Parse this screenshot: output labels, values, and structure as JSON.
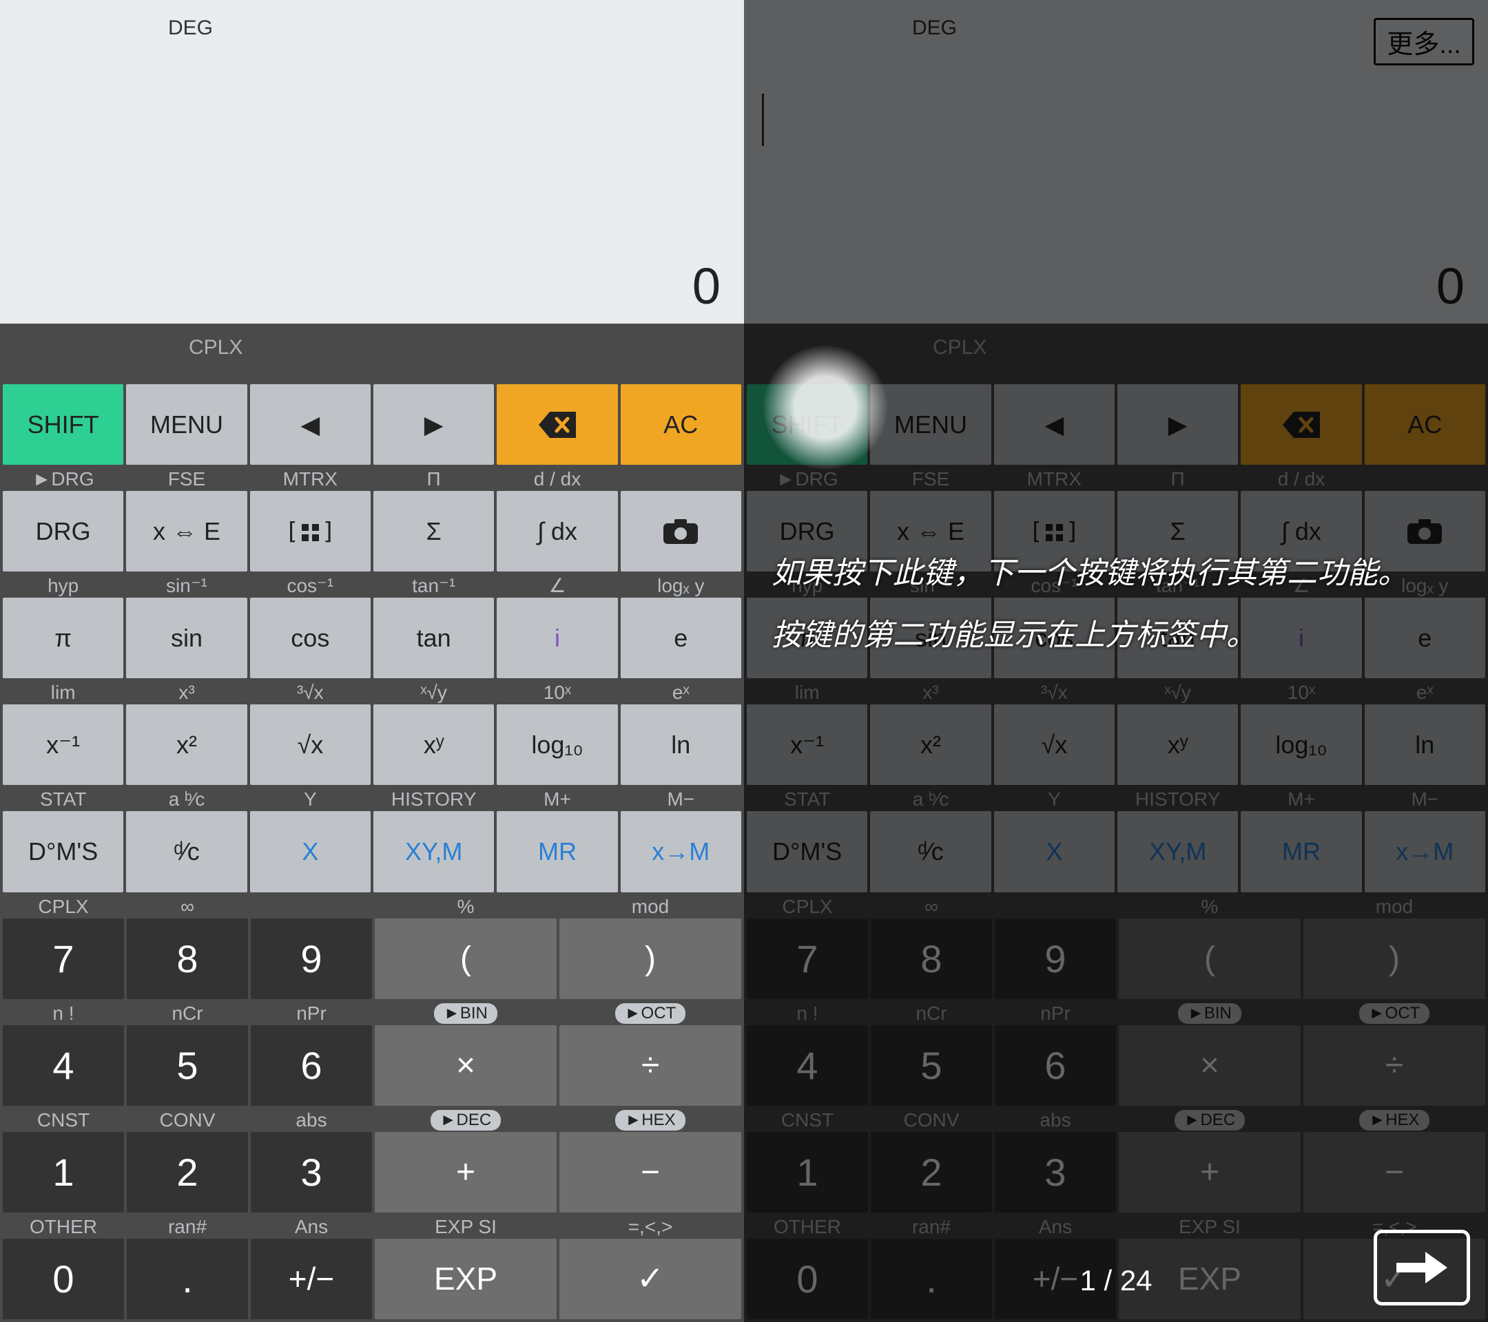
{
  "display": {
    "mode": "DEG",
    "value": "0",
    "sub": "CPLX"
  },
  "overlay": {
    "more": "更多...",
    "tip1": "如果按下此键，下一个按键将执行其第二功能。",
    "tip2": "按键的第二功能显示在上方标签中。",
    "pager": "1 / 24"
  },
  "rows": [
    [
      {
        "alt": "",
        "main": "SHIFT",
        "cls": "shift",
        "name": "shift-button"
      },
      {
        "alt": "",
        "main": "MENU",
        "cls": "fn",
        "name": "menu-button"
      },
      {
        "alt": "",
        "main": "◀",
        "cls": "fn",
        "name": "left-button"
      },
      {
        "alt": "",
        "main": "▶",
        "cls": "fn",
        "name": "right-button"
      },
      {
        "alt": "",
        "main": "",
        "cls": "orange",
        "icon": "backspace",
        "name": "backspace-button"
      },
      {
        "alt": "",
        "main": "AC",
        "cls": "orange",
        "name": "clear-button"
      }
    ],
    [
      {
        "alt": "►DRG",
        "main": "DRG",
        "cls": "fn",
        "name": "drg-button"
      },
      {
        "alt": "FSE",
        "main": "x ⇔ E",
        "cls": "fn",
        "name": "xe-button"
      },
      {
        "alt": "MTRX",
        "main": "",
        "cls": "fn",
        "icon": "matrix",
        "name": "matrix-button"
      },
      {
        "alt": "Π",
        "main": "Σ",
        "cls": "fn",
        "name": "sigma-button"
      },
      {
        "alt": "d / dx",
        "main": "∫ dx",
        "cls": "fn",
        "name": "integral-button"
      },
      {
        "alt": "",
        "main": "",
        "cls": "fn",
        "icon": "camera",
        "name": "camera-button"
      }
    ],
    [
      {
        "alt": "hyp",
        "main": "π",
        "cls": "fn",
        "name": "pi-button"
      },
      {
        "alt": "sin⁻¹",
        "main": "sin",
        "cls": "fn",
        "name": "sin-button"
      },
      {
        "alt": "cos⁻¹",
        "main": "cos",
        "cls": "fn",
        "name": "cos-button"
      },
      {
        "alt": "tan⁻¹",
        "main": "tan",
        "cls": "fn",
        "name": "tan-button"
      },
      {
        "alt": "∠",
        "main": "i",
        "cls": "fn",
        "mainCls": "purple",
        "name": "i-button"
      },
      {
        "alt": "logₓ y",
        "main": "e",
        "cls": "fn",
        "name": "e-button"
      }
    ],
    [
      {
        "alt": "lim",
        "main": "x⁻¹",
        "cls": "fn",
        "name": "xinv-button"
      },
      {
        "alt": "x³",
        "main": "x²",
        "cls": "fn",
        "name": "x2-button"
      },
      {
        "alt": "³√x",
        "main": "√x",
        "cls": "fn",
        "name": "sqrt-button"
      },
      {
        "alt": "ˣ√y",
        "main": "xʸ",
        "cls": "fn",
        "name": "xy-button"
      },
      {
        "alt": "10ˣ",
        "main": "log₁₀",
        "cls": "fn",
        "name": "log-button"
      },
      {
        "alt": "eˣ",
        "main": "ln",
        "cls": "fn",
        "name": "ln-button"
      }
    ],
    [
      {
        "alt": "STAT",
        "main": "D°M'S",
        "cls": "fn",
        "name": "dms-button"
      },
      {
        "alt": "a ᵇ⁄c",
        "main": "ᵈ⁄c",
        "cls": "fn",
        "name": "frac-button"
      },
      {
        "alt": "Y",
        "main": "X",
        "cls": "fn",
        "mainCls": "blue",
        "name": "x-button"
      },
      {
        "alt": "HISTORY",
        "main": "XY,M",
        "cls": "fn",
        "mainCls": "blue",
        "name": "xym-button"
      },
      {
        "alt": "M+",
        "main": "MR",
        "cls": "fn",
        "mainCls": "blue",
        "name": "mr-button"
      },
      {
        "alt": "M−",
        "main": "x→M",
        "cls": "fn",
        "mainCls": "blue",
        "name": "xtom-button"
      }
    ],
    [
      {
        "alt": "CPLX",
        "main": "7",
        "cls": "num",
        "name": "digit-7"
      },
      {
        "alt": "∞",
        "main": "8",
        "cls": "num",
        "name": "digit-8"
      },
      {
        "alt": "",
        "main": "9",
        "cls": "num",
        "name": "digit-9"
      },
      {
        "alt": "%",
        "main": "(",
        "cls": "op",
        "name": "lparen-button"
      },
      {
        "alt": "mod",
        "main": ")",
        "cls": "op",
        "name": "rparen-button"
      }
    ],
    [
      {
        "alt": "n !",
        "main": "4",
        "cls": "num",
        "name": "digit-4"
      },
      {
        "alt": "nCr",
        "main": "5",
        "cls": "num",
        "name": "digit-5"
      },
      {
        "alt": "nPr",
        "main": "6",
        "cls": "num",
        "name": "digit-6"
      },
      {
        "altPill": "►BIN",
        "main": "×",
        "cls": "op",
        "name": "multiply-button"
      },
      {
        "altPill": "►OCT",
        "main": "÷",
        "cls": "op",
        "name": "divide-button"
      }
    ],
    [
      {
        "alt": "CNST",
        "main": "1",
        "cls": "num",
        "name": "digit-1"
      },
      {
        "alt": "CONV",
        "main": "2",
        "cls": "num",
        "name": "digit-2"
      },
      {
        "alt": "abs",
        "main": "3",
        "cls": "num",
        "name": "digit-3"
      },
      {
        "altPill": "►DEC",
        "main": "+",
        "cls": "op",
        "name": "plus-button"
      },
      {
        "altPill": "►HEX",
        "main": "−",
        "cls": "op",
        "name": "minus-button"
      }
    ],
    [
      {
        "alt": "OTHER",
        "main": "0",
        "cls": "num",
        "name": "digit-0"
      },
      {
        "alt": "ran#",
        "main": ".",
        "cls": "num",
        "name": "dot-button"
      },
      {
        "alt": "Ans",
        "main": "+/−",
        "cls": "num",
        "name": "pm-button",
        "mainSize": "46px"
      },
      {
        "alt": "EXP SI",
        "main": "EXP",
        "cls": "op",
        "name": "exp-button",
        "mainSize": "46px"
      },
      {
        "alt": "=,<,>",
        "main": "✓",
        "cls": "op",
        "name": "equals-button"
      }
    ]
  ]
}
